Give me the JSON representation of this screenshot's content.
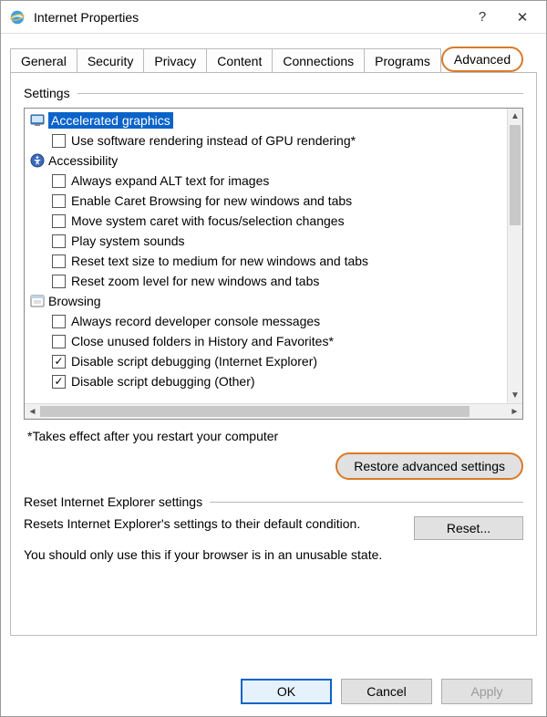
{
  "window": {
    "title": "Internet Properties",
    "help": "?",
    "close": "✕"
  },
  "tabs": [
    {
      "label": "General"
    },
    {
      "label": "Security"
    },
    {
      "label": "Privacy"
    },
    {
      "label": "Content"
    },
    {
      "label": "Connections"
    },
    {
      "label": "Programs"
    },
    {
      "label": "Advanced",
      "active": true,
      "highlight": true
    }
  ],
  "settings": {
    "label": "Settings",
    "categories": [
      {
        "icon": "display-icon",
        "label": "Accelerated graphics",
        "selected": true,
        "items": [
          {
            "label": "Use software rendering instead of GPU rendering*",
            "checked": false
          }
        ]
      },
      {
        "icon": "accessibility-icon",
        "label": "Accessibility",
        "items": [
          {
            "label": "Always expand ALT text for images",
            "checked": false
          },
          {
            "label": "Enable Caret Browsing for new windows and tabs",
            "checked": false
          },
          {
            "label": "Move system caret with focus/selection changes",
            "checked": false
          },
          {
            "label": "Play system sounds",
            "checked": false
          },
          {
            "label": "Reset text size to medium for new windows and tabs",
            "checked": false
          },
          {
            "label": "Reset zoom level for new windows and tabs",
            "checked": false
          }
        ]
      },
      {
        "icon": "browsing-icon",
        "label": "Browsing",
        "items": [
          {
            "label": "Always record developer console messages",
            "checked": false
          },
          {
            "label": "Close unused folders in History and Favorites*",
            "checked": false
          },
          {
            "label": "Disable script debugging (Internet Explorer)",
            "checked": true
          },
          {
            "label": "Disable script debugging (Other)",
            "checked": true
          }
        ]
      }
    ],
    "footnote": "*Takes effect after you restart your computer",
    "restore_button": "Restore advanced settings"
  },
  "reset": {
    "label": "Reset Internet Explorer settings",
    "description": "Resets Internet Explorer's settings to their default condition.",
    "button": "Reset...",
    "note": "You should only use this if your browser is in an unusable state."
  },
  "buttons": {
    "ok": "OK",
    "cancel": "Cancel",
    "apply": "Apply"
  }
}
